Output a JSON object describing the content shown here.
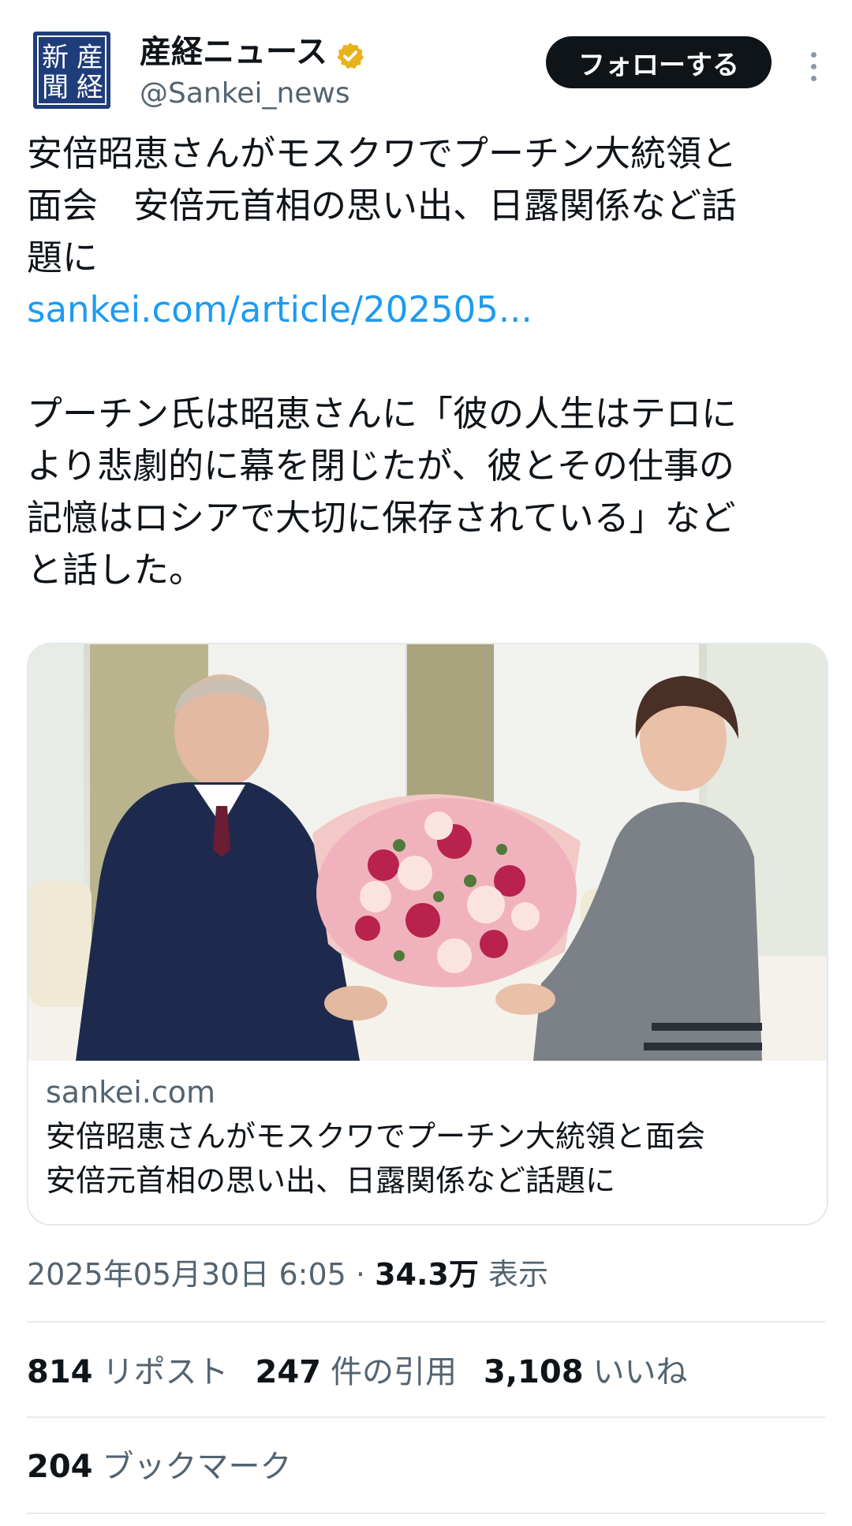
{
  "account": {
    "display_name": "産経ニュース",
    "handle": "@Sankei_news",
    "avatar_text": "産経新聞",
    "verified": true
  },
  "actions": {
    "follow_label": "フォローする",
    "more_icon": "more-vertical-icon"
  },
  "tweet": {
    "headline_lines": [
      "安倍昭恵さんがモスクワでプーチン大統領と",
      "面会　安倍元首相の思い出、日露関係など話",
      "題に"
    ],
    "link": "sankei.com/article/202505...",
    "body_lines": [
      "プーチン氏は昭恵さんに「彼の人生はテロに",
      "より悲劇的に幕を閉じたが、彼とその仕事の",
      "記憶はロシアで大切に保存されている」など",
      "と話した。"
    ]
  },
  "card": {
    "domain": "sankei.com",
    "title_lines": [
      "安倍昭恵さんがモスクワでプーチン大統領と面会",
      "安倍元首相の思い出、日露関係など話題に"
    ]
  },
  "meta": {
    "timestamp": "2025年05月30日 6:05",
    "separator": " · ",
    "views": "34.3万",
    "views_label": "表示"
  },
  "stats": {
    "reposts": "814",
    "reposts_label": "リポスト",
    "quotes": "247",
    "quotes_label": "件の引用",
    "likes": "3,108",
    "likes_label": "いいね",
    "bookmarks": "204",
    "bookmarks_label": "ブックマーク"
  },
  "colors": {
    "link": "#1d9bf0",
    "verified_gold": "#e8b21a",
    "secondary_text": "#536471",
    "follow_bg": "#0f1419"
  }
}
